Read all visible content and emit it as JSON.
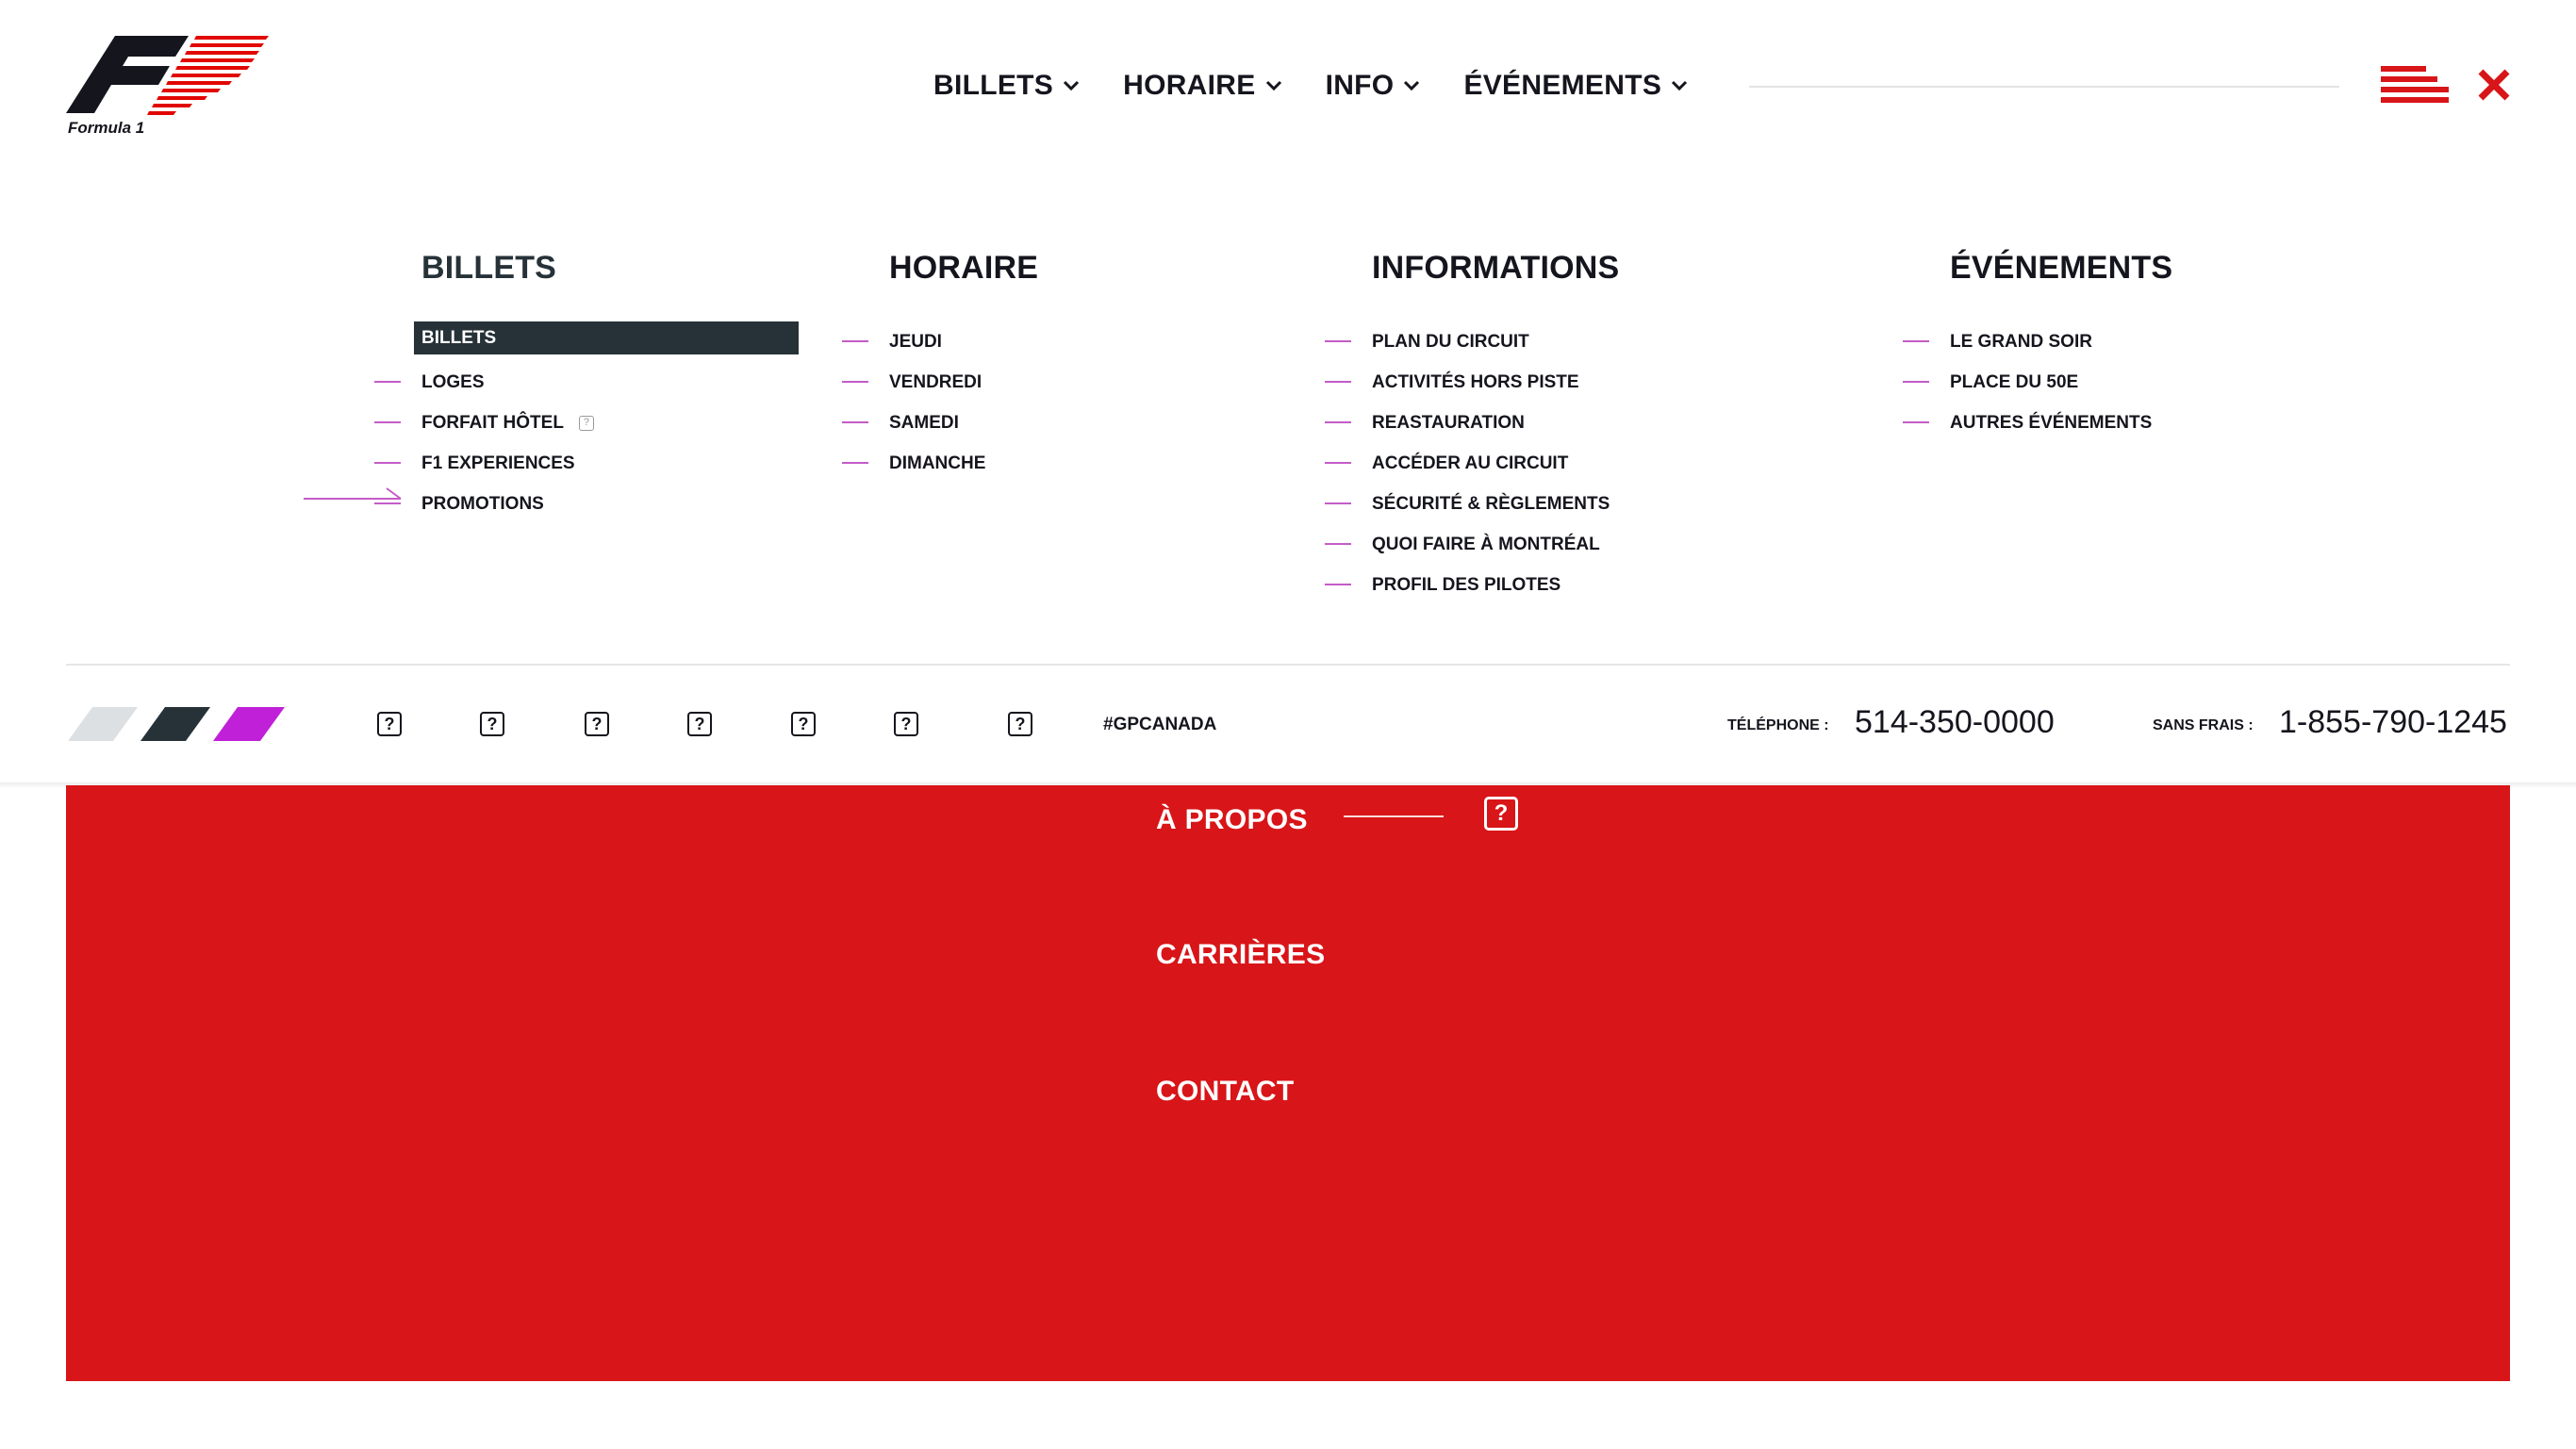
{
  "header": {
    "logo_text": "Formula 1",
    "nav": [
      {
        "label": "BILLETS"
      },
      {
        "label": "HORAIRE"
      },
      {
        "label": "INFO"
      },
      {
        "label": "ÉVÉNEMENTS"
      }
    ]
  },
  "mega_menu": {
    "columns": [
      {
        "title": "BILLETS",
        "items": [
          "BILLETS",
          "LOGES",
          "FORFAIT HÔTEL",
          "F1 EXPERIENCES",
          "PROMOTIONS"
        ],
        "active_item": "BILLETS"
      },
      {
        "title": "HORAIRE",
        "items": [
          "JEUDI",
          "VENDREDI",
          "SAMEDI",
          "DIMANCHE"
        ]
      },
      {
        "title": "INFORMATIONS",
        "items": [
          "PLAN DU CIRCUIT",
          "ACTIVITÉS HORS PISTE",
          "REASTAURATION",
          "ACCÉDER AU CIRCUIT",
          "SÉCURITÉ & RÈGLEMENTS",
          "QUOI FAIRE À MONTRÉAL",
          "PROFIL DES PILOTES"
        ]
      },
      {
        "title": "ÉVÉNEMENTS",
        "items": [
          "LE GRAND SOIR",
          "PLACE DU 50E",
          "AUTRES ÉVÉNEMENTS"
        ]
      }
    ],
    "footer": {
      "hashtag": "#GPCANADA",
      "phone_label": "TÉLÉPHONE :",
      "phone": "514-350-0000",
      "tollfree_label": "SANS FRAIS :",
      "tollfree": "1-855-790-1245",
      "social_icon_glyph": "?"
    }
  },
  "red_panel": {
    "links": [
      "À PROPOS",
      "CARRIÈRES",
      "CONTACT"
    ],
    "icon_glyph": "?"
  },
  "colors": {
    "f1_red": "#d81518",
    "dark": "#263238",
    "accent_purple": "#c45cc8",
    "stripe_grey": "#dde0e3"
  }
}
